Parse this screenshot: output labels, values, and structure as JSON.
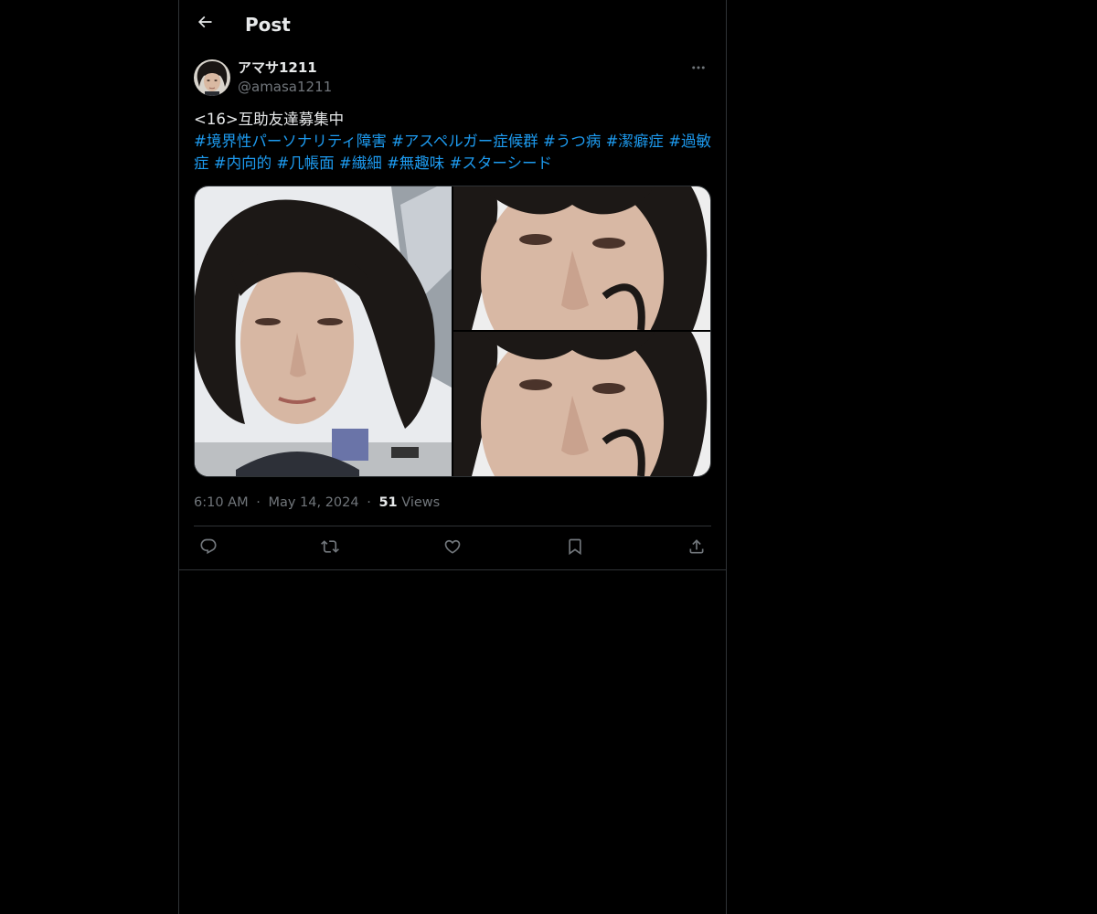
{
  "header": {
    "title": "Post",
    "back_icon": "arrow-left-icon"
  },
  "author": {
    "name": "アマサ1211",
    "handle": "@amasa1211",
    "more_icon": "more-horizontal-icon"
  },
  "tweet": {
    "text_line": "<16>互助友達募集中",
    "hashtags": [
      "#境界性パーソナリティ障害",
      "#アスペルガー症候群",
      "#うつ病",
      "#潔癖症",
      "#過敏症",
      "#内向的",
      "#几帳面",
      "#繊細",
      "#無趣味",
      "#スターシード"
    ]
  },
  "media": {
    "count": 3,
    "layout": "one-left-two-right"
  },
  "meta": {
    "time": "6:10 AM",
    "separator": "·",
    "date": "May 14, 2024",
    "views_count": "51",
    "views_label": "Views"
  },
  "actions": [
    {
      "name": "reply",
      "icon": "reply-icon"
    },
    {
      "name": "repost",
      "icon": "repost-icon"
    },
    {
      "name": "like",
      "icon": "heart-icon"
    },
    {
      "name": "bookmark",
      "icon": "bookmark-icon"
    },
    {
      "name": "share",
      "icon": "share-icon"
    }
  ],
  "colors": {
    "background": "#000000",
    "text": "#e7e9ea",
    "secondary": "#71767b",
    "link": "#1d9bf0",
    "border": "#2f3336"
  }
}
